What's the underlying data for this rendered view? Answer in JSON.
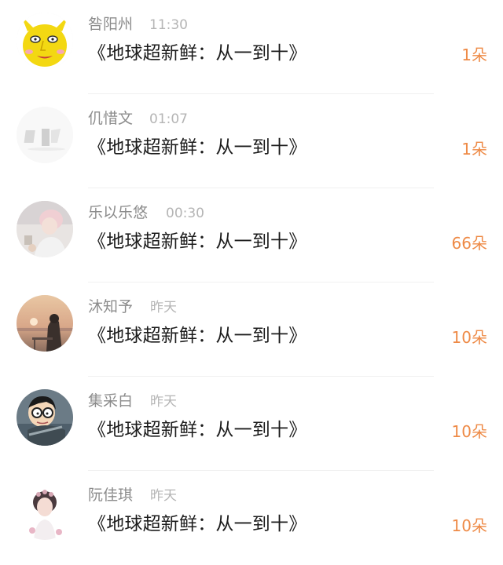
{
  "comments": [
    {
      "name": "咎阳州",
      "time": "11:30",
      "content": "《地球超新鲜：从一到十》",
      "count": "1朵"
    },
    {
      "name": "仉惜文",
      "time": "01:07",
      "content": "《地球超新鲜：从一到十》",
      "count": "1朵"
    },
    {
      "name": "乐以乐悠",
      "time": "00:30",
      "content": "《地球超新鲜：从一到十》",
      "count": "66朵"
    },
    {
      "name": "沐知予",
      "time": "昨天",
      "content": "《地球超新鲜：从一到十》",
      "count": "10朵"
    },
    {
      "name": "集采白",
      "time": "昨天",
      "content": "《地球超新鲜：从一到十》",
      "count": "10朵"
    },
    {
      "name": "阮佳琪",
      "time": "昨天",
      "content": "《地球超新鲜：从一到十》",
      "count": "10朵"
    }
  ],
  "colors": {
    "count": "#ee8a46",
    "name": "#8c8c8c",
    "time": "#b5b5b5",
    "content": "#1c1c1c"
  }
}
